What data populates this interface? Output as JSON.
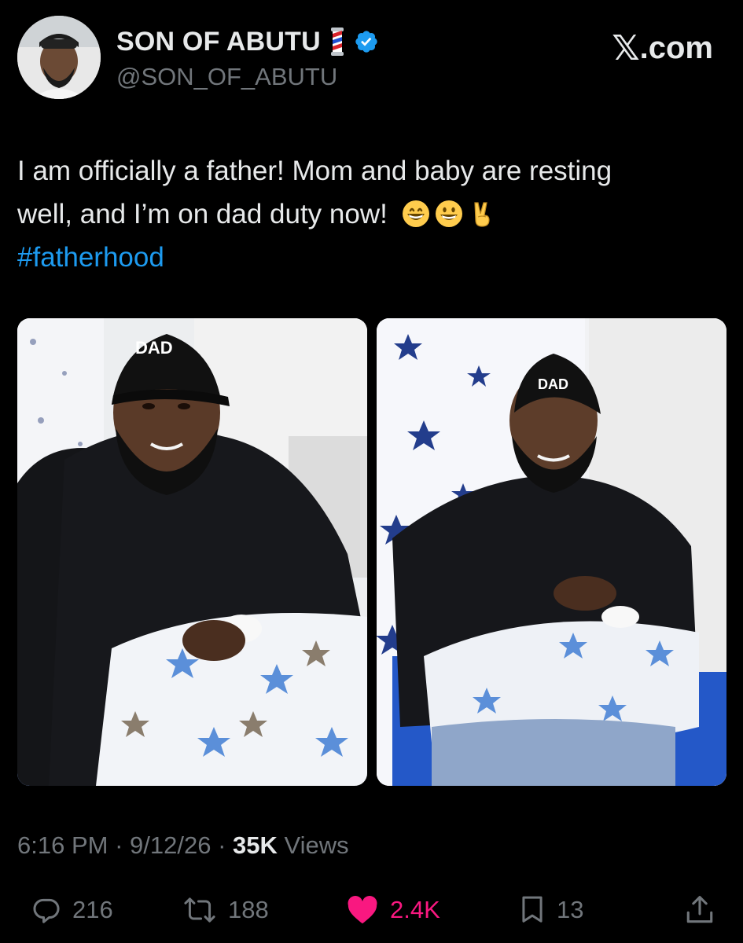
{
  "author": {
    "display_name": "SON OF ABUTU",
    "handle": "@SON_OF_ABUTU",
    "name_emoji": "barber-pole-icon",
    "verified": true,
    "verified_color": "#1d9bf0"
  },
  "brand": {
    "mark": "𝕏",
    "label": ".com"
  },
  "tweet": {
    "line1": "I am officially a father! Mom and baby are resting",
    "line2": "well, and I’m on dad duty now!",
    "hashtag": "#fatherhood",
    "emojis": [
      "grinning-face-icon",
      "grinning-face-icon",
      "victory-hand-icon"
    ],
    "photo_cap_text": "DAD"
  },
  "meta": {
    "time": "6:16 PM",
    "separator": " · ",
    "date": "9/12/26",
    "views_count": "35K",
    "views_label": " Views"
  },
  "actions": {
    "replies": "216",
    "reposts": "188",
    "likes": "2.4K",
    "bookmarks": "13"
  },
  "colors": {
    "background": "#000000",
    "text": "#e7e9ea",
    "muted": "#71767b",
    "link": "#1d9bf0",
    "like": "#f91880"
  }
}
